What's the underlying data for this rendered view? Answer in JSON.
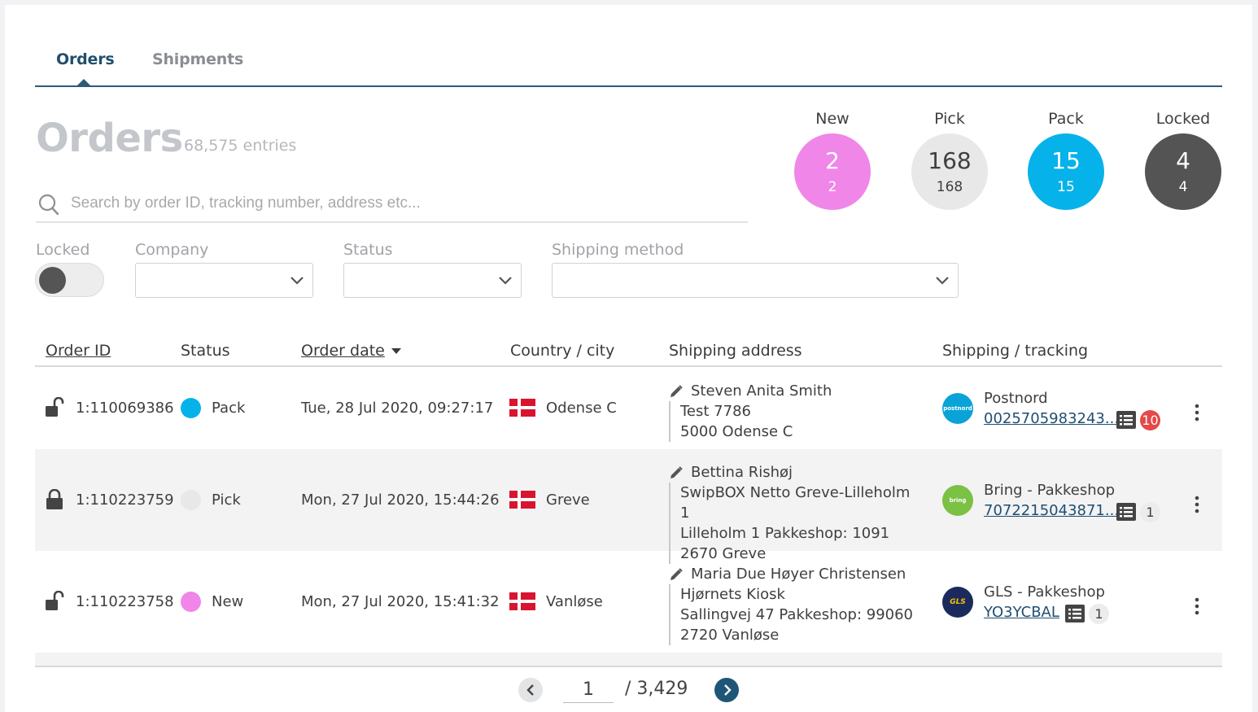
{
  "tabs": [
    {
      "label": "Orders",
      "active": true
    },
    {
      "label": "Shipments",
      "active": false
    }
  ],
  "page": {
    "title": "Orders",
    "entries": "68,575 entries"
  },
  "search": {
    "placeholder": "Search by order ID, tracking number, address etc..."
  },
  "stats": [
    {
      "label": "New",
      "big": "2",
      "small": "2",
      "color": "#ef86e8",
      "text_color": "#ffffff"
    },
    {
      "label": "Pick",
      "big": "168",
      "small": "168",
      "color": "#e8e8e8",
      "text_color": "#3f3f3f"
    },
    {
      "label": "Pack",
      "big": "15",
      "small": "15",
      "color": "#06b2ea",
      "text_color": "#ffffff"
    },
    {
      "label": "Locked",
      "big": "4",
      "small": "4",
      "color": "#545454",
      "text_color": "#ffffff"
    }
  ],
  "filters": {
    "locked_label": "Locked",
    "company_label": "Company",
    "status_label": "Status",
    "shipping_method_label": "Shipping method"
  },
  "table": {
    "headers": {
      "order_id": "Order ID",
      "status": "Status",
      "order_date": "Order date",
      "country_city": "Country / city",
      "shipping_address": "Shipping address",
      "shipping_tracking": "Shipping / tracking"
    },
    "rows": [
      {
        "order_id": "1:110069386",
        "locked": false,
        "status": "Pack",
        "status_color": "#06b2ea",
        "date": "Tue, 28 Jul 2020, 09:27:17",
        "city": "Odense C",
        "name": "Steven Anita Smith",
        "address": [
          "Test 7786",
          "5000 Odense C"
        ],
        "carrier_logo": "postnord",
        "carrier_color": "#0aa3d8",
        "carrier": "Postnord",
        "tracking": "0025705983243...",
        "count": "10",
        "count_style": "red"
      },
      {
        "order_id": "1:110223759",
        "locked": true,
        "status": "Pick",
        "status_color": "#e8e8e8",
        "date": "Mon, 27 Jul 2020, 15:44:26",
        "city": "Greve",
        "name": "Bettina Rishøj",
        "address": [
          "SwipBOX Netto Greve-Lilleholm 1",
          "Lilleholm 1 Pakkeshop: 1091",
          "2670 Greve"
        ],
        "carrier_logo": "bring",
        "carrier_color": "#7bc143",
        "carrier": "Bring - Pakkeshop",
        "tracking": "7072215043871...",
        "count": "1",
        "count_style": "grey"
      },
      {
        "order_id": "1:110223758",
        "locked": false,
        "status": "New",
        "status_color": "#ef86e8",
        "date": "Mon, 27 Jul 2020, 15:41:32",
        "city": "Vanløse",
        "name": "Maria Due Høyer Christensen",
        "address": [
          "Hjørnets Kiosk",
          "Sallingvej 47 Pakkeshop: 99060",
          "2720 Vanløse"
        ],
        "carrier_logo": "GLS",
        "carrier_color": "#1b2a5c",
        "carrier": "GLS - Pakkeshop",
        "tracking": "YO3YCBAL",
        "count": "1",
        "count_style": "grey"
      }
    ]
  },
  "pagination": {
    "current": "1",
    "total": "/  3,429"
  },
  "icons": {
    "search": "search-icon",
    "lock_open": "unlock-icon",
    "lock_closed": "lock-icon",
    "pencil": "pencil-icon",
    "list": "list-icon",
    "kebab": "kebab-menu-icon",
    "flag": "denmark-flag-icon",
    "chevron": "chevron-down-icon"
  }
}
